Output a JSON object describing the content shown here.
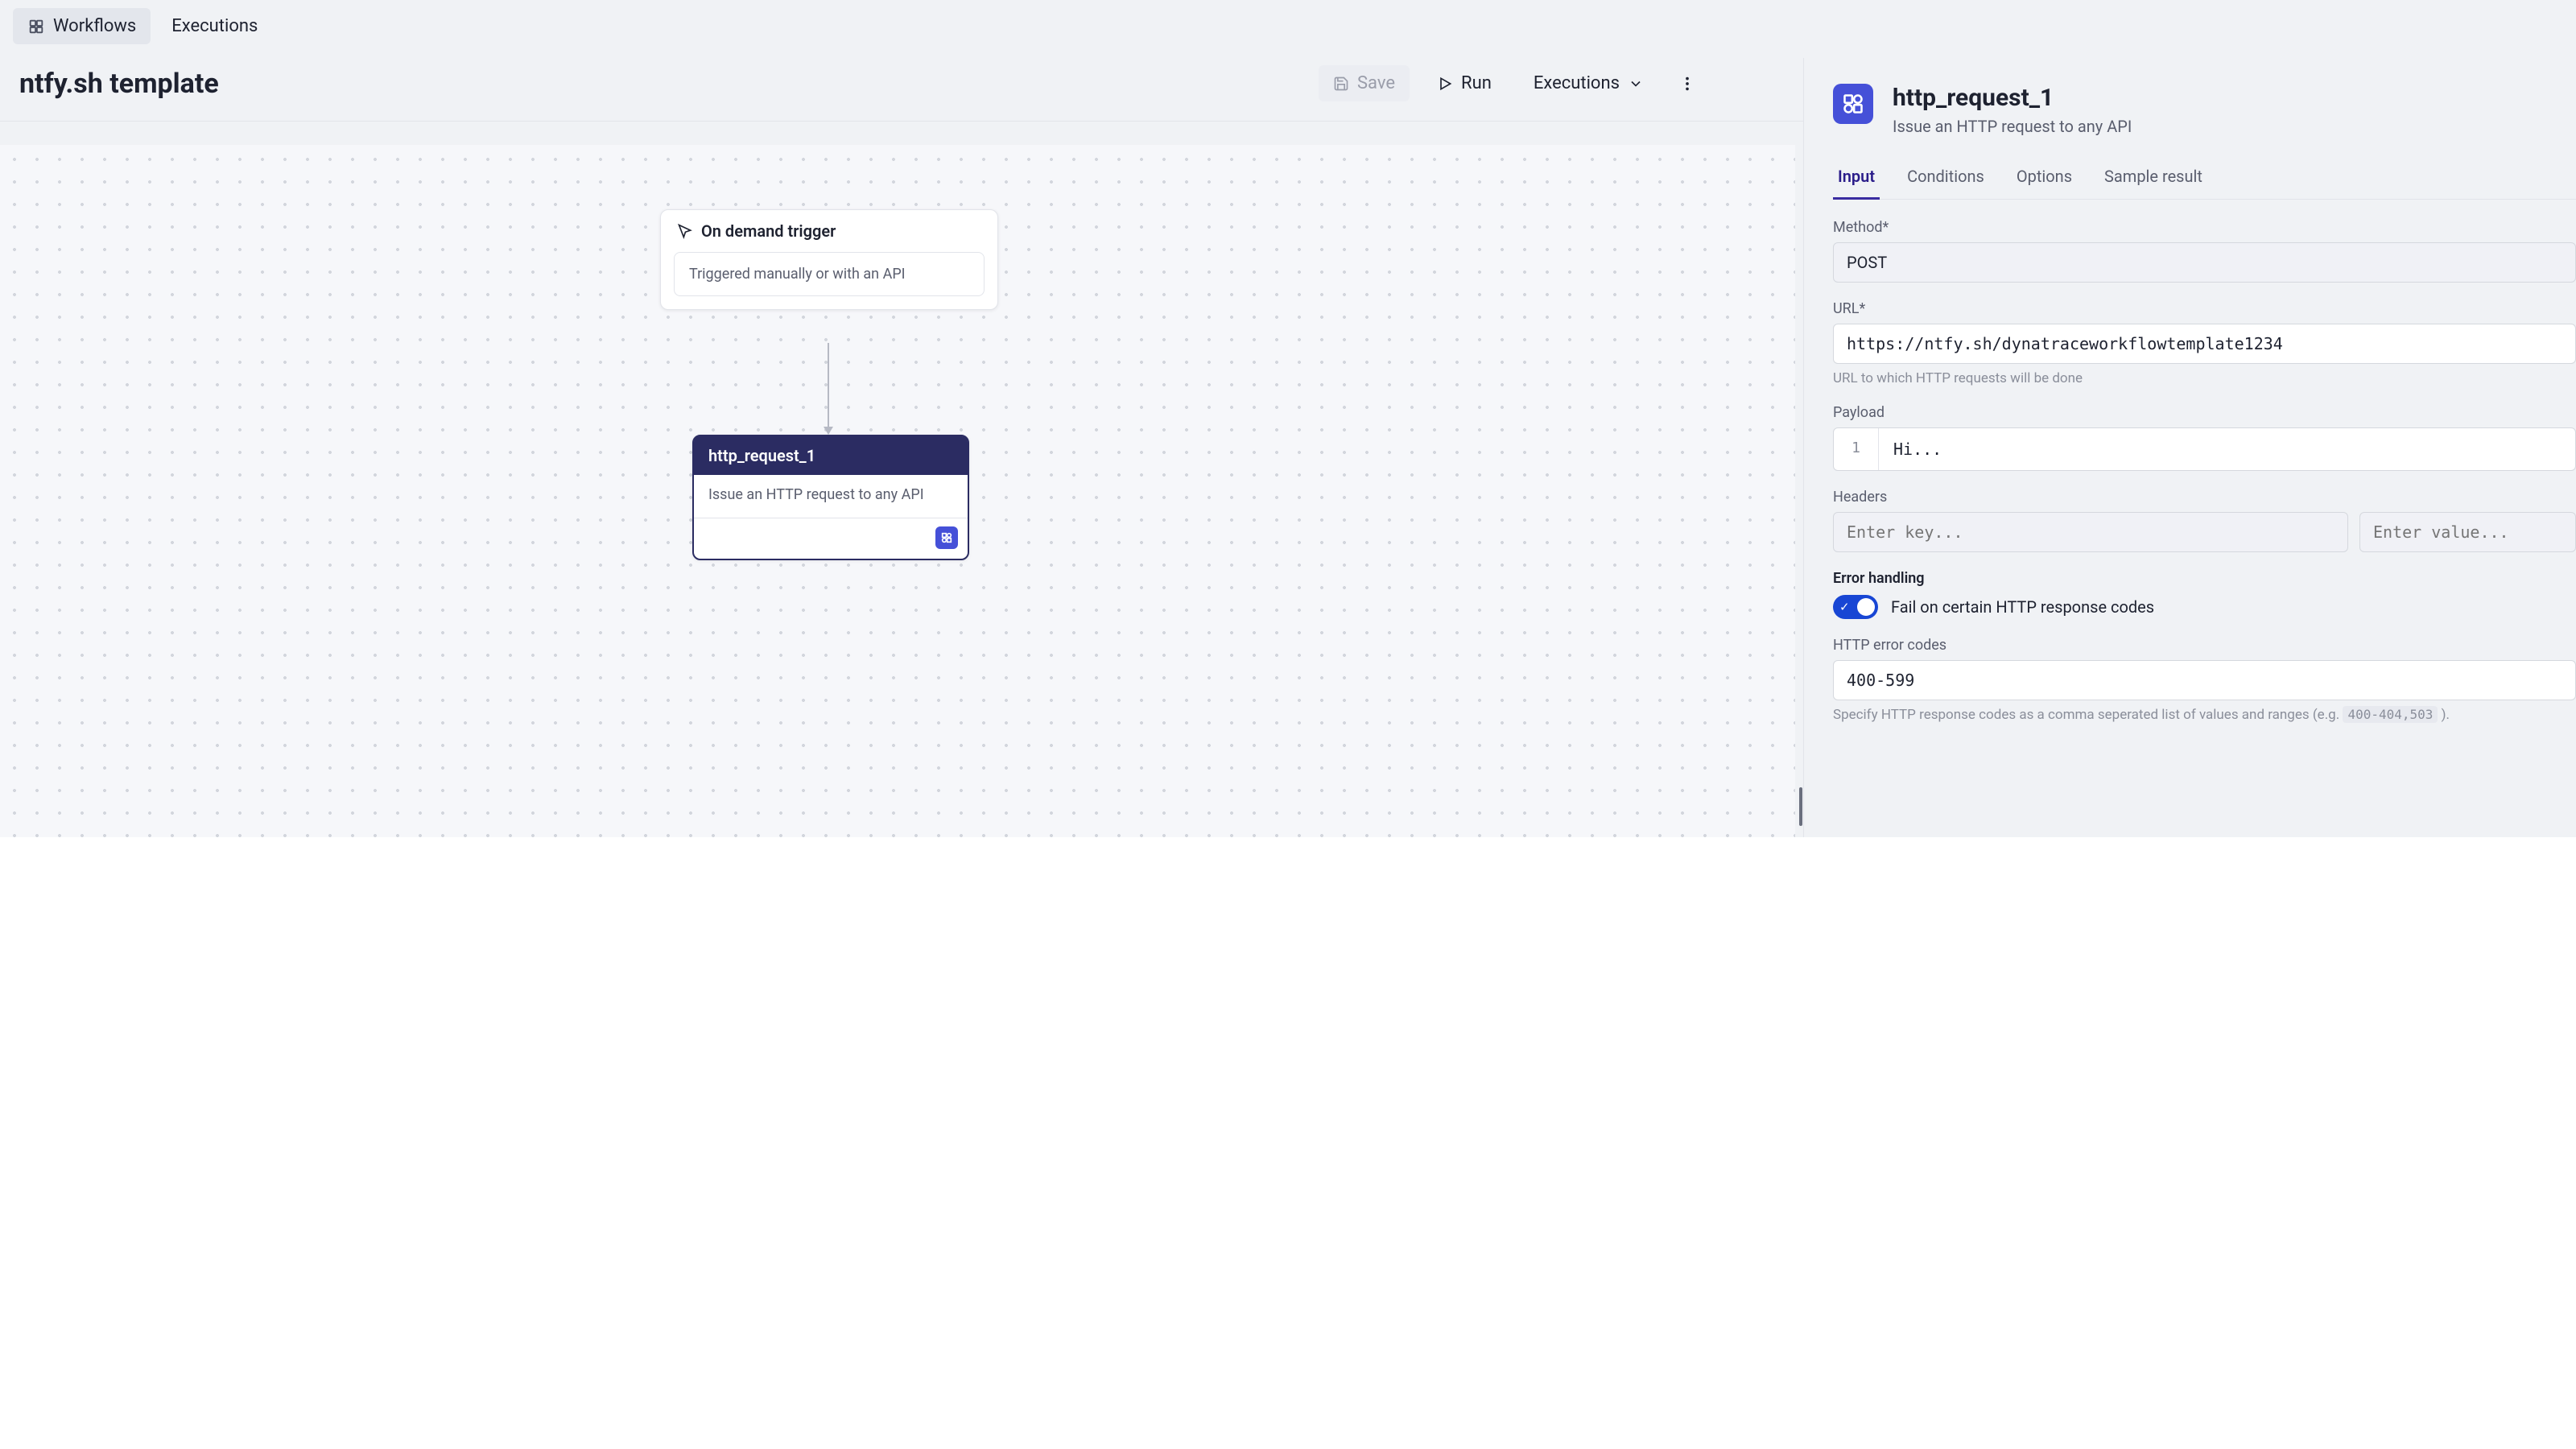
{
  "topTabs": {
    "workflows": "Workflows",
    "executions": "Executions"
  },
  "workflow": {
    "title": "ntfy.sh template"
  },
  "headerButtons": {
    "save": "Save",
    "run": "Run",
    "executions": "Executions"
  },
  "canvas": {
    "trigger": {
      "title": "On demand trigger",
      "description": "Triggered manually or with an API"
    },
    "httpNode": {
      "title": "http_request_1",
      "description": "Issue an HTTP request to any API"
    }
  },
  "sidePanel": {
    "title": "http_request_1",
    "subtitle": "Issue an HTTP request to any API",
    "tabs": {
      "input": "Input",
      "conditions": "Conditions",
      "options": "Options",
      "sample": "Sample result"
    },
    "form": {
      "methodLabel": "Method*",
      "methodValue": "POST",
      "urlLabel": "URL*",
      "urlValue": "https://ntfy.sh/dynatraceworkflowtemplate1234",
      "urlHelp": "URL to which HTTP requests will be done",
      "payloadLabel": "Payload",
      "payloadLine": "1",
      "payloadValue": "Hi...",
      "headersLabel": "Headers",
      "headersKeyPlaceholder": "Enter key...",
      "headersValuePlaceholder": "Enter value...",
      "errorHandlingLabel": "Error handling",
      "toggleLabel": "Fail on certain HTTP response codes",
      "errorCodesLabel": "HTTP error codes",
      "errorCodesValue": "400-599",
      "errorCodesHelpPrefix": "Specify HTTP response codes as a comma seperated list of values and ranges (e.g. ",
      "errorCodesHelpCode": "400-404,503",
      "errorCodesHelpSuffix": " )."
    }
  }
}
